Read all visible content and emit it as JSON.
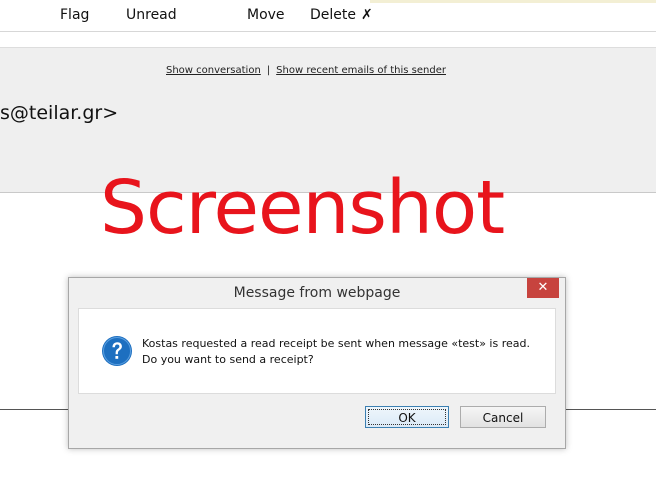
{
  "toolbar": {
    "flag": "Flag",
    "unread": "Unread",
    "move": "Move",
    "delete": "Delete",
    "delete_icon": "✗"
  },
  "header": {
    "show_conversation": "Show conversation",
    "separator": "|",
    "show_recent": "Show recent emails of this sender",
    "sender_partial": "s@teilar.gr>"
  },
  "watermark": "Screenshot",
  "dialog": {
    "title": "Message from webpage",
    "close_glyph": "✕",
    "message": "Kostas requested a read receipt be sent when message «test» is read. Do you want to send a receipt?",
    "ok_label": "OK",
    "cancel_label": "Cancel",
    "icon": "question-icon"
  },
  "colors": {
    "watermark": "#e8141c",
    "close_button": "#c7433e",
    "question_icon": "#1d6fc0"
  }
}
